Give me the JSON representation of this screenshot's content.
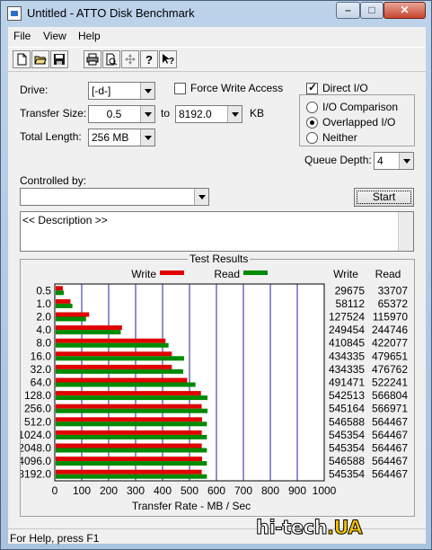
{
  "window": {
    "title": "Untitled - ATTO Disk Benchmark"
  },
  "menu": {
    "file": "File",
    "view": "View",
    "help": "Help"
  },
  "toolbar": {
    "icons": [
      "new-file-icon",
      "open-folder-icon",
      "save-disk-icon",
      "print-icon",
      "print-preview-icon",
      "move-crosshair-icon",
      "help-question-icon",
      "context-help-icon"
    ]
  },
  "drive": {
    "label": "Drive:",
    "value": "[-d-]"
  },
  "force_write_access": {
    "label": "Force Write Access",
    "checked": false
  },
  "direct_io": {
    "label": "Direct I/O",
    "checked": true
  },
  "transfer_size": {
    "label": "Transfer Size:",
    "from": "0.5",
    "to_label": "to",
    "to": "8192.0",
    "unit": "KB"
  },
  "total_length": {
    "label": "Total Length:",
    "value": "256 MB"
  },
  "io_mode": {
    "options": [
      "I/O Comparison",
      "Overlapped I/O",
      "Neither"
    ],
    "selected": "Overlapped I/O"
  },
  "queue_depth": {
    "label": "Queue Depth:",
    "value": "4"
  },
  "controlled_by": {
    "label": "Controlled by:",
    "value": ""
  },
  "start_button": "Start",
  "description": "<< Description >>",
  "results": {
    "title": "Test Results",
    "legend_write": "Write",
    "legend_read": "Read",
    "col_write": "Write",
    "col_read": "Read",
    "xlabel": "Transfer Rate - MB / Sec"
  },
  "chart_data": {
    "type": "bar",
    "orientation": "horizontal",
    "title": "Test Results",
    "xlabel": "Transfer Rate - MB / Sec",
    "xlim": [
      0,
      1000
    ],
    "xticks": [
      "0",
      "100",
      "200",
      "300",
      "400",
      "500",
      "600",
      "700",
      "800",
      "900",
      "1000"
    ],
    "categories": [
      "0.5",
      "1.0",
      "2.0",
      "4.0",
      "8.0",
      "16.0",
      "32.0",
      "64.0",
      "128.0",
      "256.0",
      "512.0",
      "1024.0",
      "2048.0",
      "4096.0",
      "8192.0"
    ],
    "series": [
      {
        "name": "Write",
        "color": "#e00000",
        "values": [
          29.7,
          58.1,
          127.5,
          249.5,
          410.8,
          434.3,
          434.3,
          491.5,
          542.5,
          545.2,
          546.6,
          545.4,
          545.4,
          546.6,
          545.4
        ]
      },
      {
        "name": "Read",
        "color": "#008a00",
        "values": [
          33.7,
          65.4,
          116.0,
          244.7,
          422.1,
          479.7,
          476.8,
          522.2,
          566.8,
          567.0,
          564.5,
          564.5,
          564.5,
          564.5,
          564.5
        ]
      }
    ],
    "table": {
      "write": [
        "29675",
        "58112",
        "127524",
        "249454",
        "410845",
        "434335",
        "434335",
        "491471",
        "542513",
        "545164",
        "546588",
        "545354",
        "545354",
        "546588",
        "545354"
      ],
      "read": [
        "33707",
        "65372",
        "115970",
        "244746",
        "422077",
        "479651",
        "476762",
        "522241",
        "566804",
        "566971",
        "564467",
        "564467",
        "564467",
        "564467",
        "564467"
      ]
    },
    "gridline_color": "#2020a0",
    "legend_position": "top"
  },
  "status": {
    "text": "For Help, press F1"
  },
  "watermark": {
    "main": "hi-tech",
    "suffix": ".UA"
  },
  "colors": {
    "write": "#e00000",
    "read": "#008a00"
  }
}
